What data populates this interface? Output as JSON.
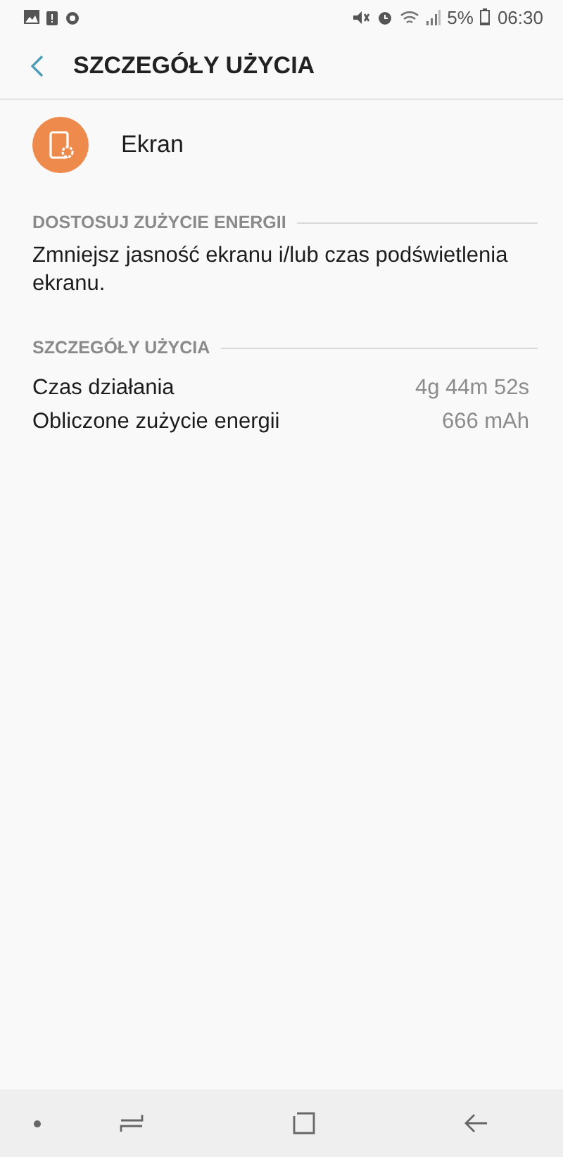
{
  "status_bar": {
    "battery_percent": "5%",
    "time": "06:30"
  },
  "header": {
    "title": "SZCZEGÓŁY UŻYCIA"
  },
  "app": {
    "name": "Ekran"
  },
  "sections": [
    {
      "title": "DOSTOSUJ ZUŻYCIE ENERGII",
      "kind": "text",
      "text": "Zmniejsz jasność ekranu i/lub czas podświetlenia ekranu."
    },
    {
      "title": "SZCZEGÓŁY UŻYCIA",
      "kind": "rows",
      "rows": [
        {
          "label": "Czas działania",
          "value": "4g 44m 52s"
        },
        {
          "label": "Obliczone zużycie energii",
          "value": "666 mAh"
        }
      ]
    }
  ]
}
